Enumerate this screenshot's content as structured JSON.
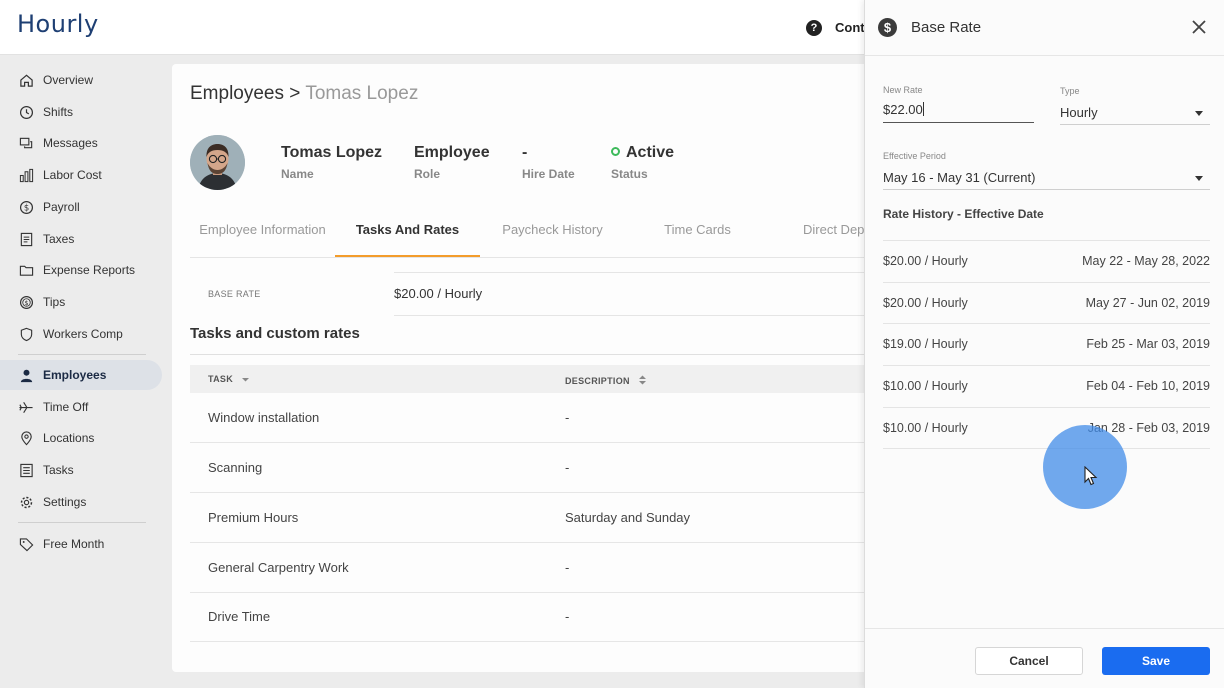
{
  "app": {
    "logo": "Hourly",
    "contact_label": "Conta"
  },
  "sidebar": {
    "items": [
      {
        "label": "Overview",
        "icon": "home-icon"
      },
      {
        "label": "Shifts",
        "icon": "clock-icon"
      },
      {
        "label": "Messages",
        "icon": "messages-icon"
      },
      {
        "label": "Labor Cost",
        "icon": "bar-chart-icon"
      },
      {
        "label": "Payroll",
        "icon": "dollar-circle-icon"
      },
      {
        "label": "Taxes",
        "icon": "document-icon"
      },
      {
        "label": "Expense Reports",
        "icon": "folder-icon"
      },
      {
        "label": "Tips",
        "icon": "coin-icon"
      },
      {
        "label": "Workers Comp",
        "icon": "shield-icon"
      },
      {
        "label": "Employees",
        "icon": "person-icon",
        "active": true
      },
      {
        "label": "Time Off",
        "icon": "plane-icon"
      },
      {
        "label": "Locations",
        "icon": "location-pin-icon"
      },
      {
        "label": "Tasks",
        "icon": "list-icon"
      },
      {
        "label": "Settings",
        "icon": "gear-icon"
      },
      {
        "label": "Free Month",
        "icon": "tag-icon"
      }
    ]
  },
  "main": {
    "breadcrumb": {
      "root": "Employees",
      "separator": " > ",
      "current": "Tomas Lopez"
    },
    "employee": {
      "name_value": "Tomas Lopez",
      "name_label": "Name",
      "role_value": "Employee",
      "role_label": "Role",
      "hire_value": "-",
      "hire_label": "Hire Date",
      "status_value": "Active",
      "status_label": "Status"
    },
    "tabs": [
      "Employee Information",
      "Tasks And Rates",
      "Paycheck History",
      "Time Cards",
      "Direct Depo"
    ],
    "active_tab": "Tasks And Rates",
    "base_rate_label": "BASE RATE",
    "base_rate_value": "$20.00 / Hourly",
    "section_title": "Tasks and custom rates",
    "table": {
      "headers": [
        "TASK",
        "DESCRIPTION"
      ],
      "rows": [
        {
          "task": "Window installation",
          "description": "-"
        },
        {
          "task": "Scanning",
          "description": "-"
        },
        {
          "task": "Premium Hours",
          "description": "Saturday and Sunday"
        },
        {
          "task": "General Carpentry Work",
          "description": "-"
        },
        {
          "task": "Drive Time",
          "description": "-"
        }
      ]
    }
  },
  "drawer": {
    "title": "Base Rate",
    "new_rate_label": "New Rate",
    "new_rate_value": "$22.00",
    "type_label": "Type",
    "type_value": "Hourly",
    "effective_label": "Effective Period",
    "effective_value": "May 16 - May 31 (Current)",
    "history_title": "Rate History - Effective Date",
    "history": [
      {
        "rate": "$20.00 / Hourly",
        "date": "May 22 - May 28, 2022"
      },
      {
        "rate": "$20.00 / Hourly",
        "date": "May 27 - Jun 02, 2019"
      },
      {
        "rate": "$19.00 / Hourly",
        "date": "Feb 25 - Mar 03, 2019"
      },
      {
        "rate": "$10.00 / Hourly",
        "date": "Feb 04 - Feb 10, 2019"
      },
      {
        "rate": "$10.00 / Hourly",
        "date": "Jan 28 - Feb 03, 2019"
      }
    ],
    "cancel_label": "Cancel",
    "save_label": "Save"
  },
  "colors": {
    "brand": "#1e3f73",
    "accent_tab": "#f39c2b",
    "save_button": "#1a6cf0",
    "active_status": "#3dba5b"
  }
}
